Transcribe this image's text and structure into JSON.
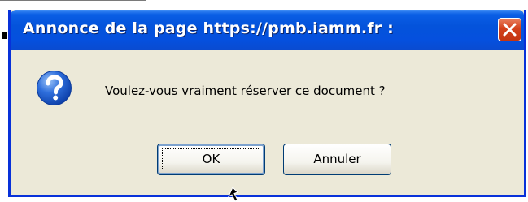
{
  "dialog": {
    "title": "Annonce de la page https://pmb.iamm.fr  :",
    "message": "Voulez-vous vraiment réserver ce document ?",
    "icon": "question-icon",
    "buttons": {
      "ok_label": "OK",
      "cancel_label": "Annuler"
    }
  },
  "colors": {
    "titlebar": "#0453db",
    "dialog_bg": "#ece9d8",
    "close_button": "#d3411c",
    "icon": "#1f5fd1"
  }
}
